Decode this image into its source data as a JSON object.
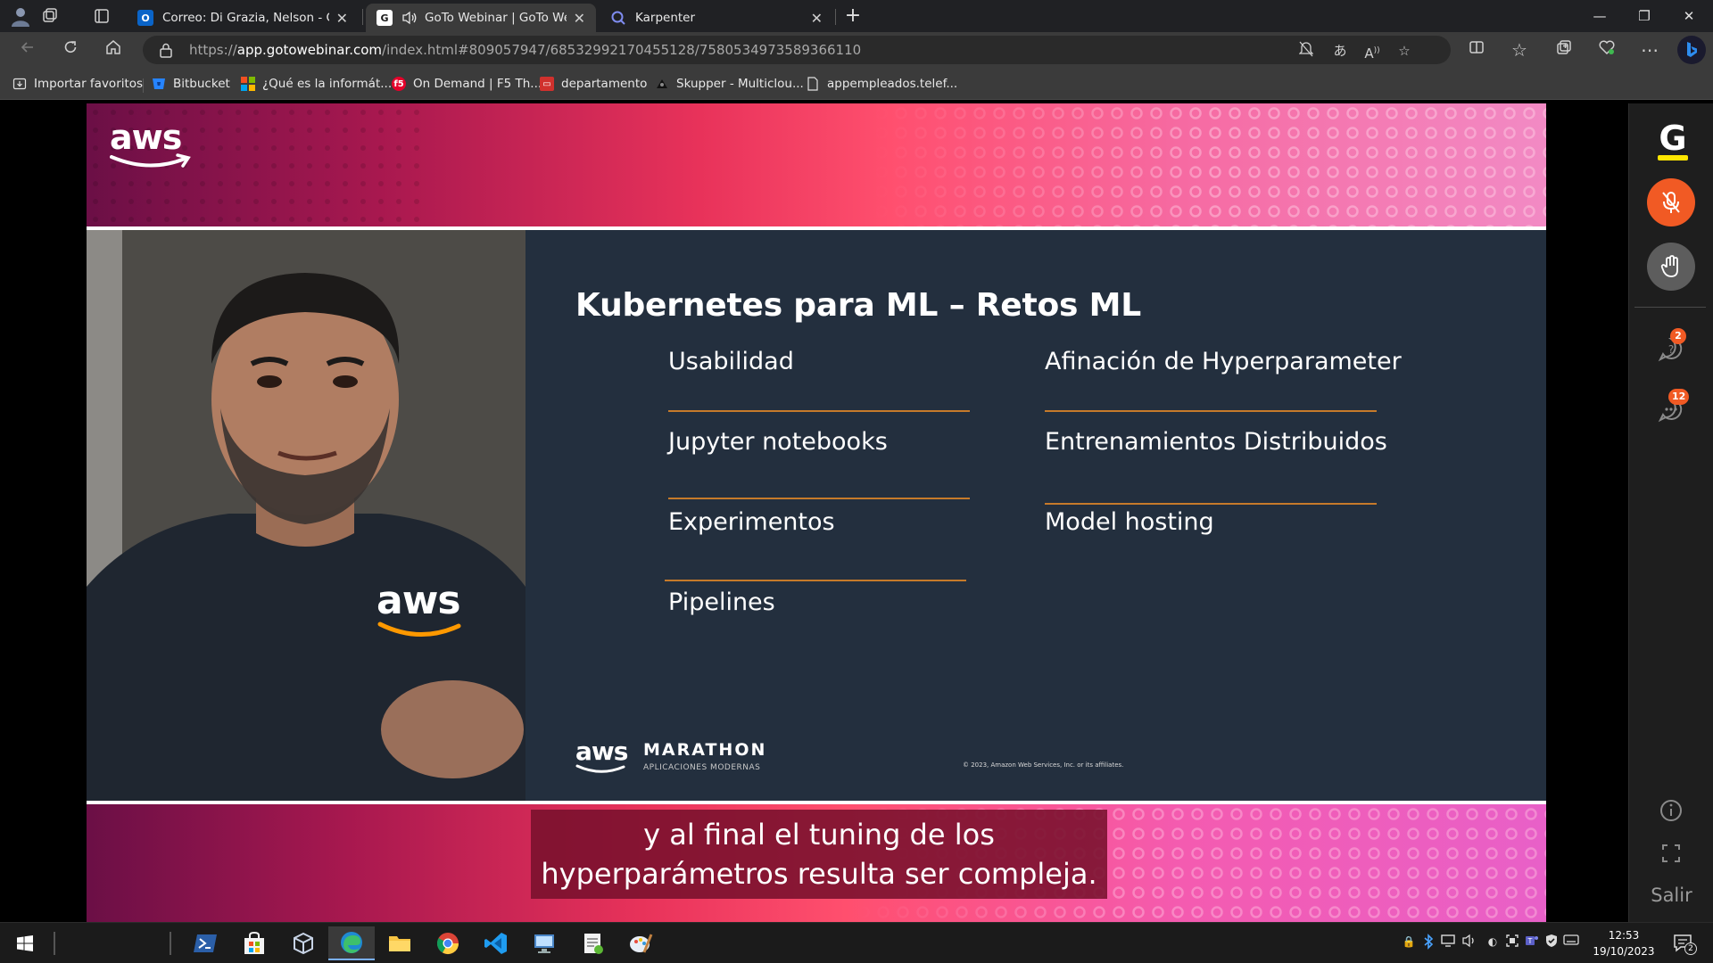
{
  "browser": {
    "tabs": [
      {
        "title": "Correo: Di Grazia, Nelson - Outlo",
        "favicon": "outlook-icon",
        "active": false
      },
      {
        "title": "GoTo Webinar | GoTo Webin",
        "favicon": "goto-icon",
        "active": true,
        "audio": true
      },
      {
        "title": "Karpenter",
        "favicon": "karpenter-icon",
        "active": false
      }
    ],
    "url": {
      "scheme": "https://",
      "host": "app.gotowebinar.com",
      "path": "/index.html#809057947/6853299217045512​8/7580534973589366110"
    },
    "bookmarks": [
      {
        "label": "Importar favoritos",
        "icon": "import-icon"
      },
      {
        "label": "Bitbucket",
        "icon": "bitbucket-icon"
      },
      {
        "label": "¿Qué es la informát...",
        "icon": "microsoft-icon"
      },
      {
        "label": "On Demand | F5 Th...",
        "icon": "f5-icon"
      },
      {
        "label": "departamento",
        "icon": "pdf-icon"
      },
      {
        "label": "Skupper - Multiclou...",
        "icon": "skupper-icon"
      },
      {
        "label": "appempleados.telef...",
        "icon": "page-icon"
      }
    ]
  },
  "slide": {
    "logo_text": "aws",
    "title": "Kubernetes para ML – Retos ML",
    "left_topics": [
      "Usabilidad",
      "Jupyter notebooks",
      "Experimentos",
      "Pipelines"
    ],
    "right_topics": [
      "Afinación de Hyperparameter",
      "Entrenamientos Distribuidos",
      "Model hosting"
    ],
    "brand_aws": "aws",
    "brand_name": "MARATHON",
    "brand_sub": "APLICACIONES MODERNAS",
    "copyright": "© 2023, Amazon Web Services, Inc. or its affiliates.",
    "shirt_logo": "aws",
    "caption_line1": "y al final el tuning de los",
    "caption_line2": "hyperparámetros resulta ser compleja."
  },
  "rail": {
    "logo": "G",
    "questions_badge": "2",
    "chat_badge": "12",
    "exit_label": "Salir"
  },
  "taskbar": {
    "time": "12:53",
    "date": "19/10/2023",
    "notifications": "2"
  },
  "colors": {
    "accent_orange": "#f15a24",
    "slide_bg": "#232f3e",
    "rule": "#c67a2a",
    "aws_smile": "#ff9900"
  }
}
